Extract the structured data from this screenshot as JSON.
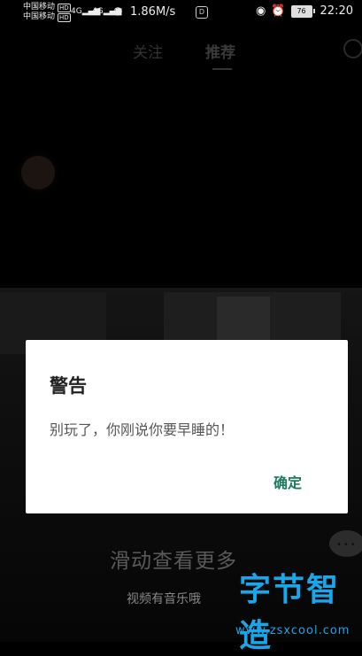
{
  "status_bar": {
    "carrier1": "中国移动",
    "carrier2": "中国移动",
    "hd": "HD",
    "signal1": "4G",
    "signal2": "4G",
    "net_speed": "1.86M/s",
    "app_badge": "D",
    "battery": "76",
    "time": "22:20"
  },
  "tabs": {
    "follow": "关注",
    "recommend": "推荐"
  },
  "dialog": {
    "title": "警告",
    "message": "别玩了，你刚说你要早睡的！",
    "ok_label": "确定",
    "accent_color": "#1c7a5a"
  },
  "hints": {
    "swipe": "滑动查看更多",
    "music": "视频有音乐哦"
  },
  "watermark": {
    "logo": "字节智造",
    "url": "www.zsxcool.com"
  }
}
